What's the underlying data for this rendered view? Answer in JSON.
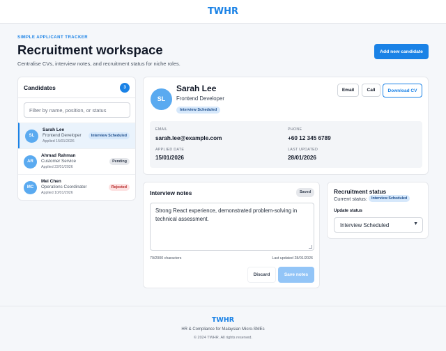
{
  "header": {
    "brand": "TWHR"
  },
  "page": {
    "eyebrow": "SIMPLE APPLICANT TRACKER",
    "title": "Recruitment workspace",
    "subtitle": "Centralise CVs, interview notes, and recruitment status for niche roles.",
    "add_button": "Add new candidate"
  },
  "candidates": {
    "title": "Candidates",
    "count": "3",
    "filter_placeholder": "Filter by name, position, or status",
    "items": [
      {
        "initials": "SL",
        "name": "Sarah Lee",
        "role": "Frontend Developer",
        "applied": "Applied 15/01/2026",
        "status": "Interview Scheduled",
        "selected": true
      },
      {
        "initials": "AR",
        "name": "Ahmad Rahman",
        "role": "Customer Service",
        "applied": "Applied 22/01/2026",
        "status": "Pending",
        "selected": false
      },
      {
        "initials": "MC",
        "name": "Mei Chen",
        "role": "Operations Coordinator",
        "applied": "Applied 10/01/2026",
        "status": "Rejected",
        "selected": false
      }
    ]
  },
  "profile": {
    "initials": "SL",
    "name": "Sarah Lee",
    "role": "Frontend Developer",
    "status": "Interview Scheduled",
    "email_button": "Email",
    "call_button": "Call",
    "download_button": "Download CV",
    "email_label": "EMAIL",
    "email": "sarah.lee@example.com",
    "phone_label": "PHONE",
    "phone": "+60 12 345 6789",
    "applied_label": "APPLIED DATE",
    "applied": "15/01/2026",
    "updated_label": "LAST UPDATED",
    "updated": "28/01/2026"
  },
  "notes": {
    "title": "Interview notes",
    "saved": "Saved",
    "text": "Strong React experience, demonstrated problem-solving in technical assessment.",
    "char_count": "79/2000 characters",
    "last_updated": "Last updated 28/01/2026",
    "discard": "Discard",
    "save": "Save notes"
  },
  "status_panel": {
    "title": "Recruitment status",
    "current_label": "Current status:",
    "current": "Interview Scheduled",
    "update_label": "Update status",
    "selected": "Interview Scheduled"
  },
  "footer": {
    "brand": "TWHR",
    "tagline": "HR & Compliance for Malaysian Micro-SMEs",
    "copyright": "© 2024 TWHR. All rights reserved."
  },
  "colors": {
    "accent": "#1a82e6",
    "badge_blue": "#d6e8fb",
    "badge_red": "#fde2e2",
    "badge_gray": "#e5e7eb"
  }
}
